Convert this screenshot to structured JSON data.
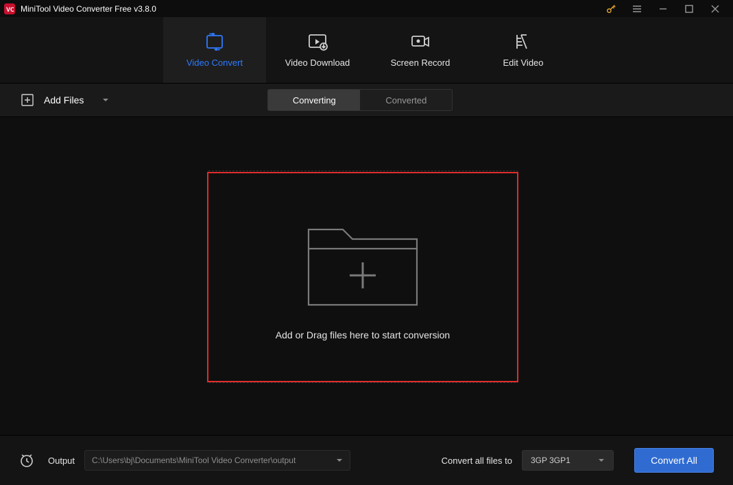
{
  "titlebar": {
    "app_name": "MiniTool Video Converter Free v3.8.0"
  },
  "main_tabs": {
    "video_convert": "Video Convert",
    "video_download": "Video Download",
    "screen_record": "Screen Record",
    "edit_video": "Edit Video"
  },
  "toolbar": {
    "add_files": "Add Files",
    "converting": "Converting",
    "converted": "Converted"
  },
  "stage": {
    "drop_text": "Add or Drag files here to start conversion"
  },
  "bottom": {
    "output_label": "Output",
    "output_path": "C:\\Users\\bj\\Documents\\MiniTool Video Converter\\output",
    "convert_all_label": "Convert all files to",
    "format_selected": "3GP 3GP1",
    "convert_all_button": "Convert All"
  }
}
